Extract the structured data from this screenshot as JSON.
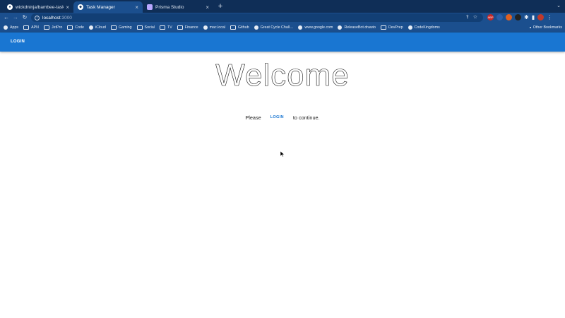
{
  "browser": {
    "tabs": [
      {
        "title": "wickdninja/bambee-task-mana…",
        "favicon": "github-icon",
        "active": false
      },
      {
        "title": "Task Manager",
        "favicon": "app-icon",
        "active": true
      },
      {
        "title": "Prisma Studio",
        "favicon": "prisma-icon",
        "active": false
      }
    ],
    "address": {
      "host": "localhost",
      "port": ":3000"
    },
    "bookmarks": [
      {
        "label": "Apps",
        "icon": "apps-grid-icon"
      },
      {
        "label": "APN",
        "icon": "folder-icon"
      },
      {
        "label": "JetPro",
        "icon": "folder-icon"
      },
      {
        "label": "Code",
        "icon": "folder-icon"
      },
      {
        "label": "iCloud",
        "icon": "apple-icon"
      },
      {
        "label": "Gaming",
        "icon": "folder-icon"
      },
      {
        "label": "Social",
        "icon": "folder-icon"
      },
      {
        "label": "TV",
        "icon": "folder-icon"
      },
      {
        "label": "Finance",
        "icon": "folder-icon"
      },
      {
        "label": "mac.local",
        "icon": "globe-icon"
      },
      {
        "label": "Github",
        "icon": "folder-icon"
      },
      {
        "label": "Great Cycle Chall…",
        "icon": "site-icon"
      },
      {
        "label": "www.google.com",
        "icon": "globe-icon"
      },
      {
        "label": "ReleaseBot.drawio",
        "icon": "drawio-icon"
      },
      {
        "label": "DevPrep",
        "icon": "folder-icon"
      },
      {
        "label": "CodeKingdoms",
        "icon": "site-icon"
      }
    ],
    "other_bookmarks": "Other Bookmarks",
    "extensions": [
      {
        "name": "abp-icon",
        "color": "#c62828",
        "text": "ABP"
      },
      {
        "name": "extension-blue-icon",
        "color": "#2b5fa8",
        "text": ""
      },
      {
        "name": "extension-n-icon",
        "color": "#e06020",
        "text": ""
      },
      {
        "name": "extension-dark-icon",
        "color": "#222222",
        "text": ""
      },
      {
        "name": "extension-red-icon",
        "color": "#c0392b",
        "text": ""
      }
    ]
  },
  "app": {
    "appbar": {
      "login_label": "LOGIN",
      "color": "#1976d2"
    },
    "heading": "Welcome",
    "prompt": {
      "before": "Please",
      "link": "LOGIN",
      "after": "to continue."
    }
  }
}
